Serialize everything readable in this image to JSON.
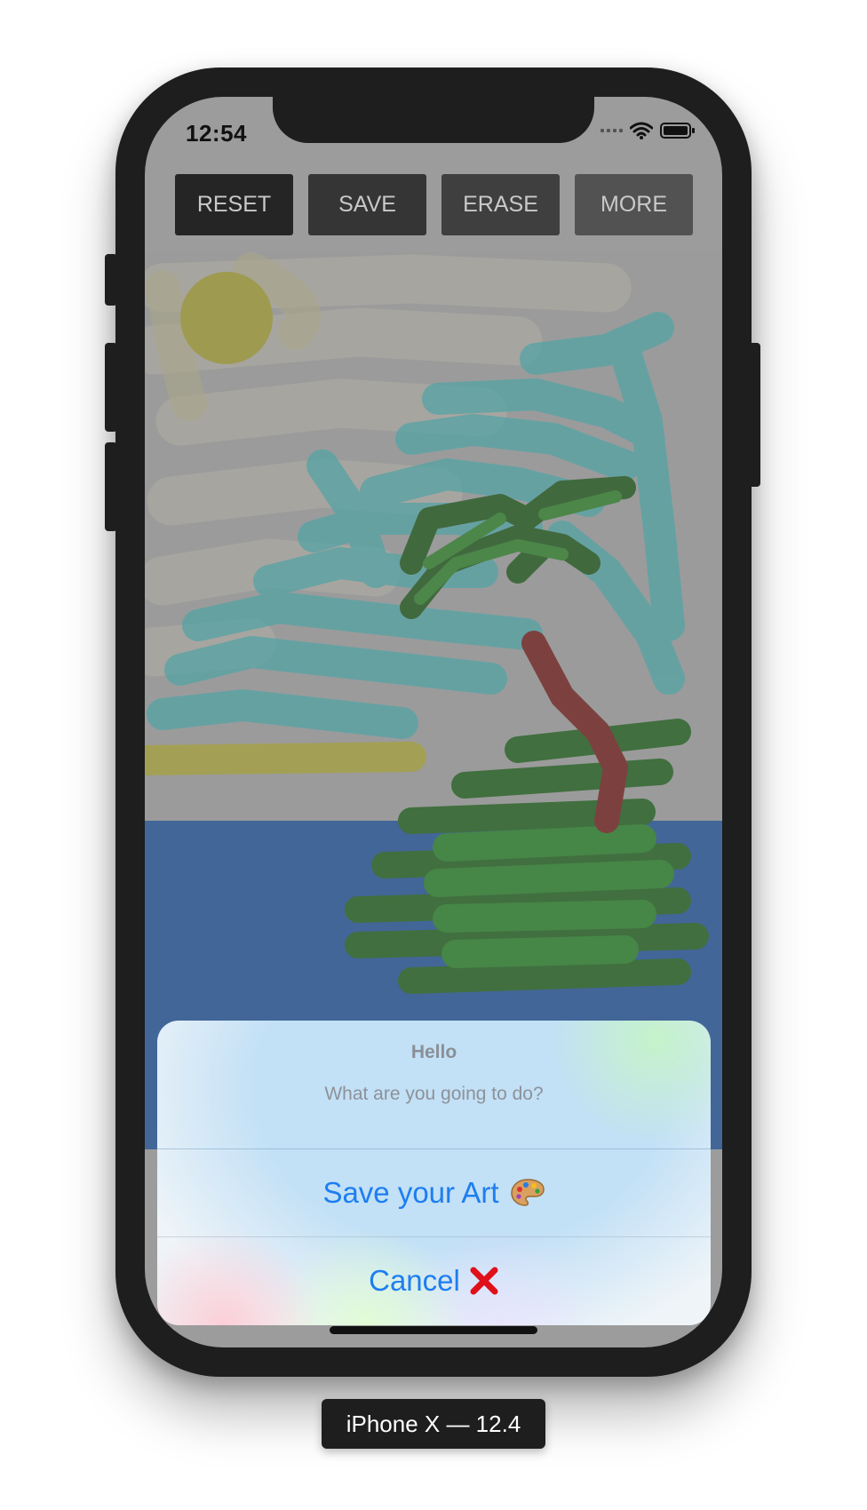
{
  "status_bar": {
    "time": "12:54"
  },
  "toolbar": {
    "buttons": [
      {
        "label": "RESET",
        "color": "#252525"
      },
      {
        "label": "SAVE",
        "color": "#353535"
      },
      {
        "label": "ERASE",
        "color": "#3f3f3f"
      },
      {
        "label": "MORE",
        "color": "#525252"
      }
    ]
  },
  "palette": {
    "colors": [
      "#9b0a12",
      "#1d8f1f",
      "#0d1a8c",
      "#8a3a93",
      "#9c9722",
      "#1a9594",
      "#9c9c9c",
      "#000000"
    ]
  },
  "action_sheet": {
    "title": "Hello",
    "message": "What are you going to do?",
    "actions": [
      {
        "label": "Save your Art",
        "icon": "palette-icon"
      },
      {
        "label": "Cancel",
        "icon": "cross-mark-icon"
      }
    ]
  },
  "device_label": "iPhone X — 12.4"
}
